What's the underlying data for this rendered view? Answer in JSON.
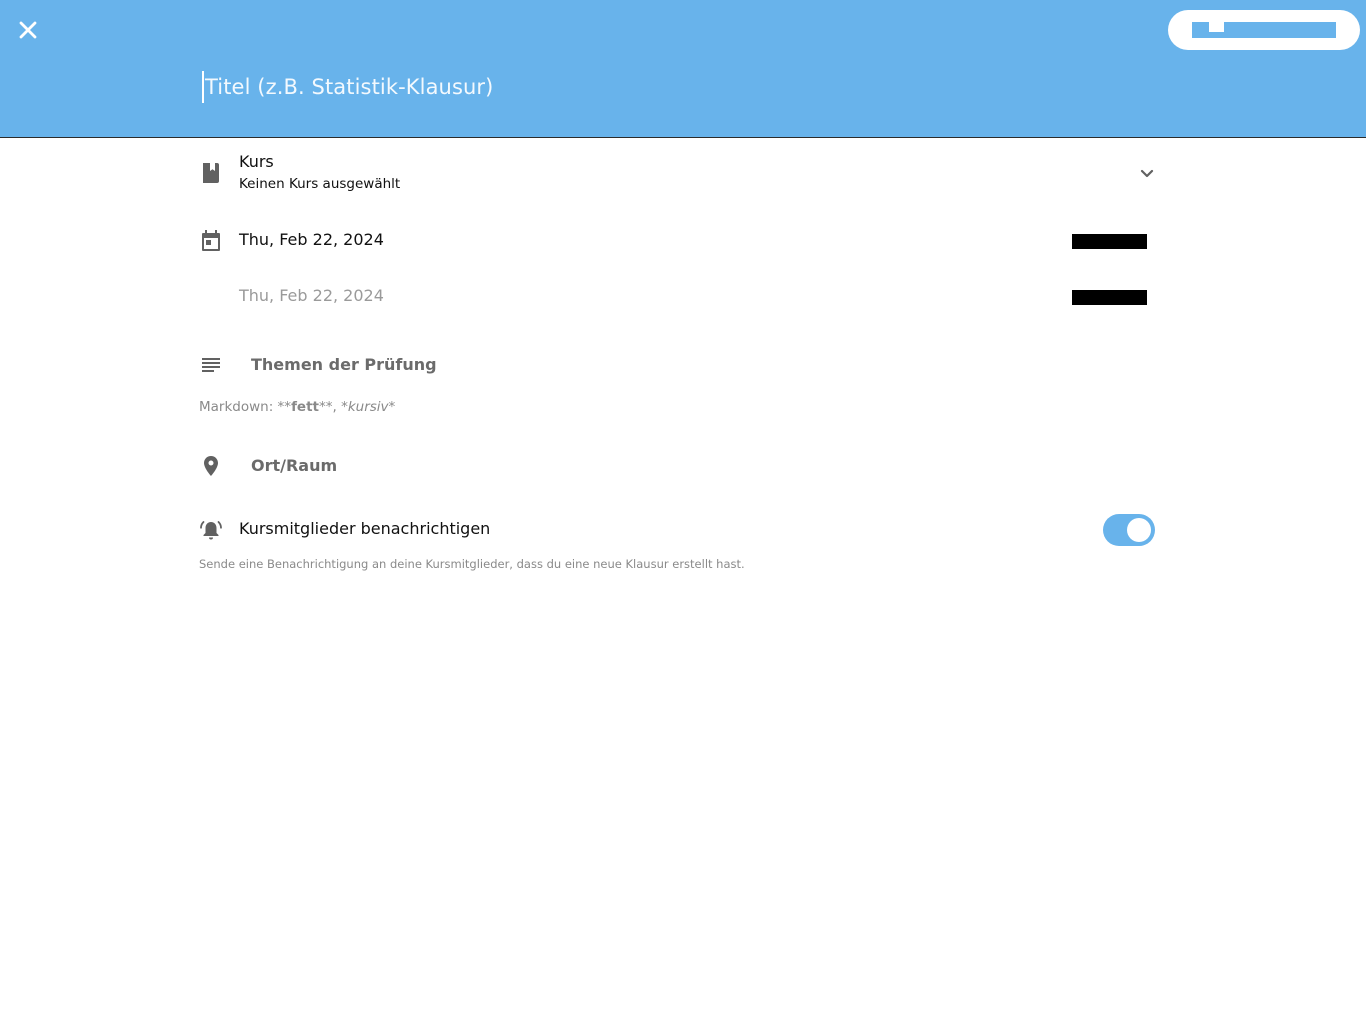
{
  "header": {
    "close_icon": "close-icon",
    "save_button_label": "",
    "title_placeholder": "Titel (z.B. Statistik-Klausur)",
    "background_color": "#68b3eb"
  },
  "course": {
    "icon": "book-icon",
    "label": "Kurs",
    "value": "Keinen Kurs ausgewählt",
    "chevron_icon": "chevron-down-icon"
  },
  "dates": {
    "icon": "calendar-icon",
    "start_date": "Thu, Feb 22, 2024",
    "end_date": "Thu, Feb 22, 2024"
  },
  "topics": {
    "icon": "notes-icon",
    "placeholder": "Themen der Prüfung",
    "markdown_prefix": "Markdown: **",
    "markdown_bold": "fett",
    "markdown_middle": "**, *",
    "markdown_italic": "kursiv",
    "markdown_suffix": "*"
  },
  "location": {
    "icon": "location-pin-icon",
    "placeholder": "Ort/Raum"
  },
  "notify": {
    "icon": "alarm-bell-icon",
    "label": "Kursmitglieder benachrichtigen",
    "enabled": true,
    "description": "Sende eine Benachrichtigung an deine Kursmitglieder, dass du eine neue Klausur erstellt hast.",
    "toggle_color": "#68b3eb"
  }
}
